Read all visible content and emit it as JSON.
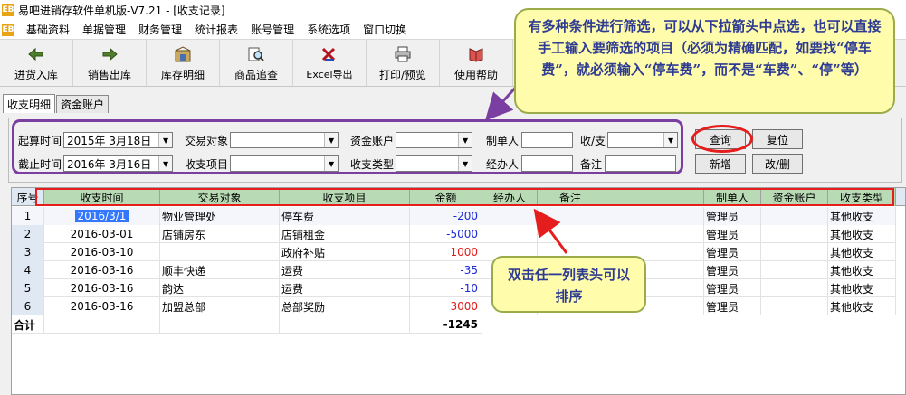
{
  "window": {
    "title": "易吧进销存软件单机版-V7.21 - [收支记录]",
    "app_icon_text": "EB"
  },
  "menu": [
    "基础资料",
    "单据管理",
    "财务管理",
    "统计报表",
    "账号管理",
    "系统选项",
    "窗口切换"
  ],
  "toolbar": [
    {
      "label": "进货入库",
      "icon": "stock-in-icon"
    },
    {
      "label": "销售出库",
      "icon": "sale-out-icon"
    },
    {
      "label": "库存明细",
      "icon": "inventory-icon"
    },
    {
      "label": "商品追查",
      "icon": "trace-icon"
    },
    {
      "label": "Excel导出",
      "icon": "excel-icon"
    },
    {
      "label": "打印/预览",
      "icon": "printer-icon"
    },
    {
      "label": "使用帮助",
      "icon": "help-book-icon"
    }
  ],
  "tabs": [
    "收支明细",
    "资金账户"
  ],
  "filters": {
    "start_label": "起算时间",
    "start_value": "2015年 3月18日",
    "end_label": "截止时间",
    "end_value": "2016年 3月16日",
    "party_label": "交易对象",
    "item_label": "收支项目",
    "account_label": "资金账户",
    "type_label": "收支类型",
    "creator_label": "制单人",
    "handler_label": "经办人",
    "inout_label": "收/支",
    "note_label": "备注"
  },
  "buttons": {
    "query": "查询",
    "reset": "复位",
    "add": "新增",
    "edit": "改/删"
  },
  "grid": {
    "columns": [
      "序号",
      "收支时间",
      "交易对象",
      "收支项目",
      "金额",
      "经办人",
      "备注",
      "制单人",
      "资金账户",
      "收支类型"
    ],
    "rows": [
      {
        "idx": "1",
        "date": "2016/3/1",
        "party": "物业管理处",
        "item": "停车费",
        "amount": "-200",
        "handler": "",
        "note": "",
        "creator": "管理员",
        "account": "",
        "type": "其他收支"
      },
      {
        "idx": "2",
        "date": "2016-03-01",
        "party": "店铺房东",
        "item": "店铺租金",
        "amount": "-5000",
        "handler": "",
        "note": "",
        "creator": "管理员",
        "account": "",
        "type": "其他收支"
      },
      {
        "idx": "3",
        "date": "2016-03-10",
        "party": "",
        "item": "政府补贴",
        "amount": "1000",
        "handler": "",
        "note": "",
        "creator": "管理员",
        "account": "",
        "type": "其他收支"
      },
      {
        "idx": "4",
        "date": "2016-03-16",
        "party": "顺丰快递",
        "item": "运费",
        "amount": "-35",
        "handler": "",
        "note": "",
        "creator": "管理员",
        "account": "",
        "type": "其他收支"
      },
      {
        "idx": "5",
        "date": "2016-03-16",
        "party": "韵达",
        "item": "运费",
        "amount": "-10",
        "handler": "",
        "note": "",
        "creator": "管理员",
        "account": "",
        "type": "其他收支"
      },
      {
        "idx": "6",
        "date": "2016-03-16",
        "party": "加盟总部",
        "item": "总部奖励",
        "amount": "3000",
        "handler": "",
        "note": "",
        "creator": "管理员",
        "account": "",
        "type": "其他收支"
      }
    ],
    "total_label": "合计",
    "total_amount": "-1245"
  },
  "callouts": {
    "filter_tip": "有多种条件进行筛选，可以从下拉箭头中点选，也可以直接手工输入要筛选的项目（必须为精确匹配，如要找“停车费”，就必须输入“停车费”，而不是“车费”、“停”等）",
    "sort_tip": "双击任一列表头可以排序"
  },
  "colors": {
    "annotation_purple": "#7a3fa0",
    "annotation_red": "#e51d1d",
    "callout_fill": "#fffcab",
    "callout_text": "#2e3b92",
    "negative_amount": "#1c2bd6",
    "positive_amount": "#e01b1b"
  }
}
